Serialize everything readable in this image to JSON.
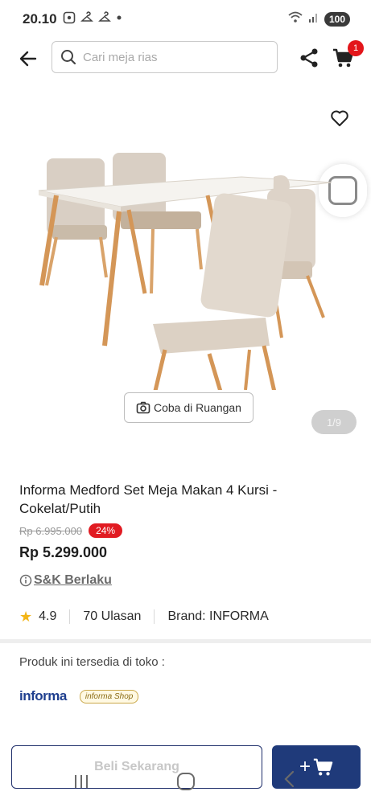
{
  "status_bar": {
    "time": "20.10",
    "battery": "100",
    "icons": [
      "screenshot-icon",
      "hanger-icon",
      "hanger-icon",
      "dot-icon",
      "wifi-icon",
      "signal-icon"
    ]
  },
  "header": {
    "search_placeholder": "Cari meja rias",
    "cart_count": "1"
  },
  "gallery": {
    "try_in_room_label": "Coba di Ruangan",
    "page_indicator": "1/9"
  },
  "product": {
    "title": "Informa Medford Set Meja Makan 4 Kursi - Cokelat/Putih",
    "old_price": "Rp 6.995.000",
    "discount": "24%",
    "current_price": "Rp 5.299.000",
    "terms_label": "S&K Berlaku",
    "rating": "4.9",
    "reviews": "70 Ulasan",
    "brand": "Brand: INFORMA"
  },
  "availability": {
    "label": "Produk ini tersedia di toko :",
    "stores": [
      "informa",
      "informa Shop"
    ]
  },
  "actions": {
    "buy_now_label": "Beli Sekarang",
    "add_to_cart_label": "+"
  },
  "colors": {
    "brand_navy": "#1f3a7a",
    "discount_red": "#e11b22",
    "star_yellow": "#f3b516"
  }
}
